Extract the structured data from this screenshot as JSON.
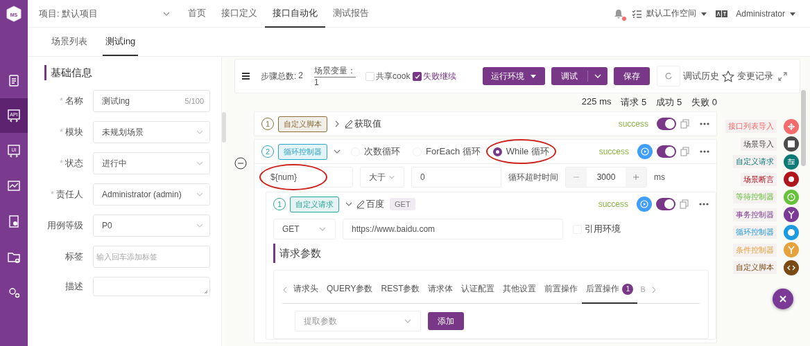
{
  "sidebar": {
    "logo": "MS",
    "items": [
      {
        "kind": "clipboard",
        "selected": false
      },
      {
        "kind": "code",
        "label": "API",
        "selected": true
      },
      {
        "kind": "code",
        "label": "UI",
        "selected": false
      },
      {
        "kind": "chart",
        "selected": false
      },
      {
        "kind": "report",
        "selected": false
      },
      {
        "kind": "folder",
        "selected": false
      },
      {
        "kind": "gears",
        "selected": false
      }
    ]
  },
  "topbar": {
    "project": "项目: 默认项目",
    "nav": [
      {
        "label": "首页",
        "selected": false
      },
      {
        "label": "接口定义",
        "selected": false
      },
      {
        "label": "接口自动化",
        "selected": true
      },
      {
        "label": "测试报告",
        "selected": false
      }
    ],
    "notification": true,
    "workspace": "默认工作空间",
    "user": "Administrator"
  },
  "tabs": [
    {
      "label": "场景列表",
      "selected": false
    },
    {
      "label": "测试ing",
      "selected": true
    }
  ],
  "basic_info": {
    "title": "基础信息",
    "fields": [
      {
        "kind": "input",
        "label": "名称",
        "required_mark": "*",
        "value": "测试ing",
        "counter": "5/100"
      },
      {
        "kind": "select",
        "label": "模块",
        "required_mark": "*",
        "value": "未规划场景"
      },
      {
        "kind": "select",
        "label": "状态",
        "required_mark": "*",
        "value": "进行中"
      },
      {
        "kind": "select",
        "label": "责任人",
        "required_mark": "*",
        "value": "Administrator (admin)"
      },
      {
        "kind": "select",
        "label": "用例等级",
        "value": "P0"
      },
      {
        "kind": "input",
        "label": "标签",
        "placeholder": "输入回车添加标签"
      },
      {
        "kind": "textarea",
        "label": "描述"
      }
    ]
  },
  "toolbar": {
    "step_total_label": "步骤总数:",
    "step_total": "2",
    "variables_label": "场景变量：",
    "variables": "1",
    "share_cookie": {
      "label": "共享cook",
      "checked": false
    },
    "fail_continue": {
      "label": "失败继续",
      "checked": true
    },
    "buttons": [
      {
        "kind": "dropdown",
        "label": "运行环境"
      },
      {
        "kind": "split",
        "label": "调试"
      },
      {
        "kind": "plain",
        "label": "保存"
      }
    ],
    "history": "调试历史",
    "changes": "变更记录"
  },
  "stats": [
    "225 ms",
    "请求 5",
    "成功 5",
    "失败 0"
  ],
  "steps": [
    {
      "kind": "script",
      "index": "1",
      "tag": "自定义脚本",
      "color": "#8a6d3b",
      "expanded": false,
      "name": "获取值",
      "status": "success",
      "runnable": false,
      "enabled": true
    },
    {
      "kind": "loop",
      "index": "2",
      "tag": "循环控制器",
      "color": "#2aa4c9",
      "expanded": true,
      "status": "success",
      "runnable": true,
      "enabled": true,
      "loop_types": [
        {
          "label": "次数循环",
          "selected": false,
          "annotated": false
        },
        {
          "label": "ForEach 循环",
          "selected": false,
          "annotated": false
        },
        {
          "label": "While 循环",
          "selected": true,
          "annotated": true
        }
      ],
      "condition": {
        "variable": "${num}",
        "variable_annotated": true,
        "operator": "大于",
        "value": "0",
        "timeout_label": "循环超时时间",
        "timeout": "3000",
        "unit": "ms"
      },
      "children": [
        {
          "kind": "request",
          "index": "1",
          "tag": "自定义请求",
          "color": "#2aa69a",
          "expanded": true,
          "name": "百度",
          "method_tag": "GET",
          "status": "success",
          "runnable": true,
          "enabled": true,
          "method": "GET",
          "url": "https://www.baidu.com",
          "use_env": {
            "label": "引用环境",
            "checked": false
          },
          "params_title": "请求参数",
          "param_tabs": [
            {
              "label": "请求头",
              "selected": false
            },
            {
              "label": "QUERY参数",
              "selected": false
            },
            {
              "label": "REST参数",
              "selected": false
            },
            {
              "label": "请求体",
              "selected": false
            },
            {
              "label": "认证配置",
              "selected": false
            },
            {
              "label": "其他设置",
              "selected": false
            },
            {
              "label": "前置操作",
              "selected": false
            },
            {
              "label": "后置操作",
              "selected": true,
              "badge": "1"
            },
            {
              "label": "B",
              "selected": false
            }
          ],
          "extract": {
            "placeholder": "提取参数",
            "button": "添加"
          }
        }
      ]
    }
  ],
  "add_menu": [
    {
      "label": "接口列表导入",
      "color": "#f56c6c",
      "kind": "target"
    },
    {
      "label": "场景导入",
      "color": "#4d4d4d",
      "kind": "clapper"
    },
    {
      "label": "自定义请求",
      "color": "#0f7a75",
      "kind": "sliders"
    },
    {
      "label": "场景断言",
      "color": "#b0151e",
      "kind": "dot"
    },
    {
      "label": "等待控制器",
      "color": "#67c23a",
      "kind": "clock"
    },
    {
      "label": "事务控制器",
      "color": "#7b3a96",
      "kind": "fork"
    },
    {
      "label": "循环控制器",
      "color": "#1e9be0",
      "kind": "loop"
    },
    {
      "label": "条件控制器",
      "color": "#e6a23c",
      "kind": "fork"
    },
    {
      "label": "自定义脚本",
      "color": "#7a4a12",
      "kind": "code"
    }
  ]
}
